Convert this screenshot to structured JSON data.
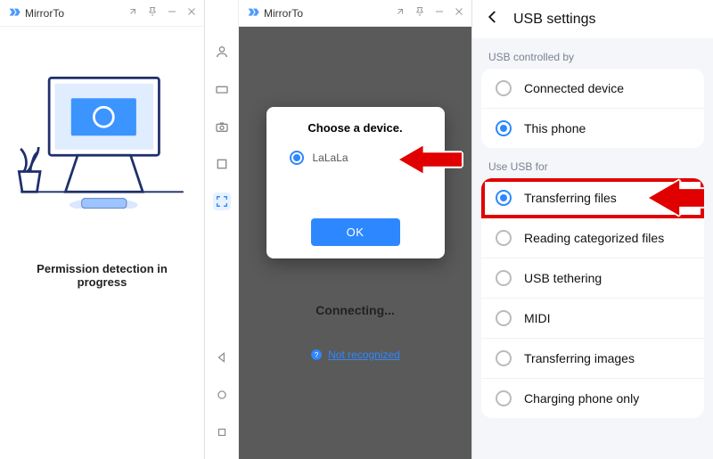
{
  "app": {
    "name": "MirrorTo"
  },
  "panel1": {
    "status": "Permission detection in progress"
  },
  "panel2": {
    "dialog_title": "Choose a device.",
    "device_name": "LaLaLa",
    "ok_label": "OK",
    "connecting": "Connecting...",
    "not_recognized": "Not recognized"
  },
  "panel3": {
    "title": "USB settings",
    "controlled_label": "USB controlled by",
    "controlled_options": [
      {
        "label": "Connected device",
        "selected": false
      },
      {
        "label": "This phone",
        "selected": true
      }
    ],
    "usefor_label": "Use USB for",
    "usefor_options": [
      {
        "label": "Transferring files",
        "selected": true,
        "highlight": true
      },
      {
        "label": "Reading categorized files",
        "selected": false
      },
      {
        "label": "USB tethering",
        "selected": false
      },
      {
        "label": "MIDI",
        "selected": false
      },
      {
        "label": "Transferring images",
        "selected": false
      },
      {
        "label": "Charging phone only",
        "selected": false
      }
    ]
  }
}
